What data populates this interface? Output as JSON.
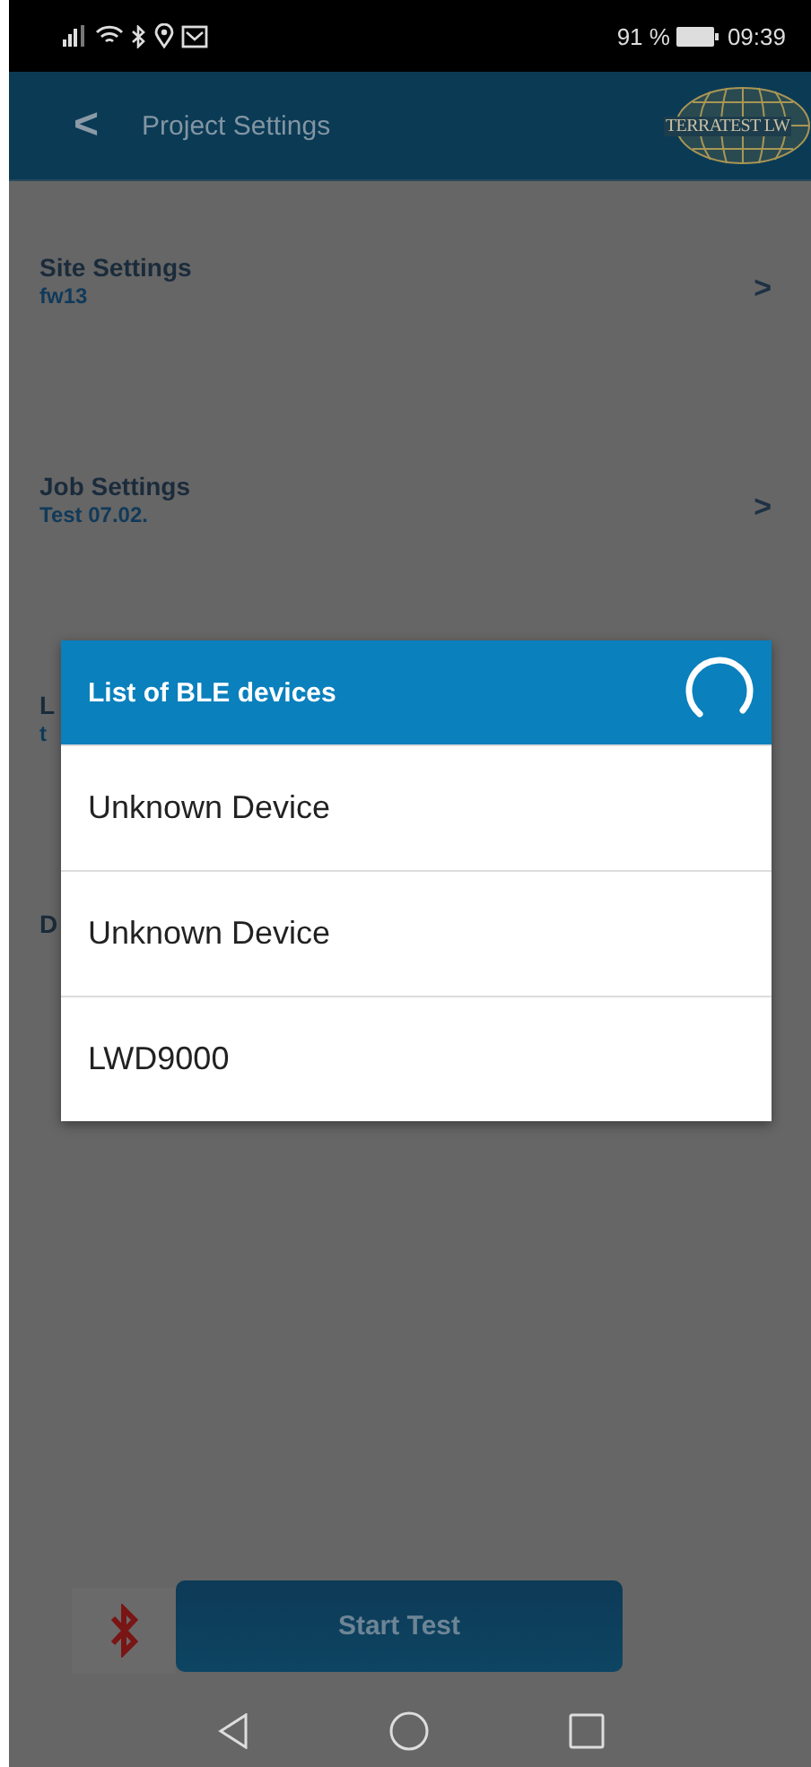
{
  "status_bar": {
    "battery": "91 %",
    "time": "09:39"
  },
  "header": {
    "back": "<",
    "title": "Project Settings",
    "logo": "TERRATEST LW"
  },
  "settings": [
    {
      "title": "Site Settings",
      "subtitle": "fw13",
      "arrow": ">"
    },
    {
      "title": "Job Settings",
      "subtitle": "Test 07.02.",
      "arrow": ">"
    },
    {
      "title": "L",
      "subtitle": "t"
    },
    {
      "title": "D"
    }
  ],
  "dialog": {
    "title": "List of BLE devices",
    "loading": true,
    "devices": [
      "Unknown Device",
      "Unknown Device",
      "LWD9000"
    ]
  },
  "footer": {
    "bluetooth_connected": false,
    "button": "Start Test"
  }
}
